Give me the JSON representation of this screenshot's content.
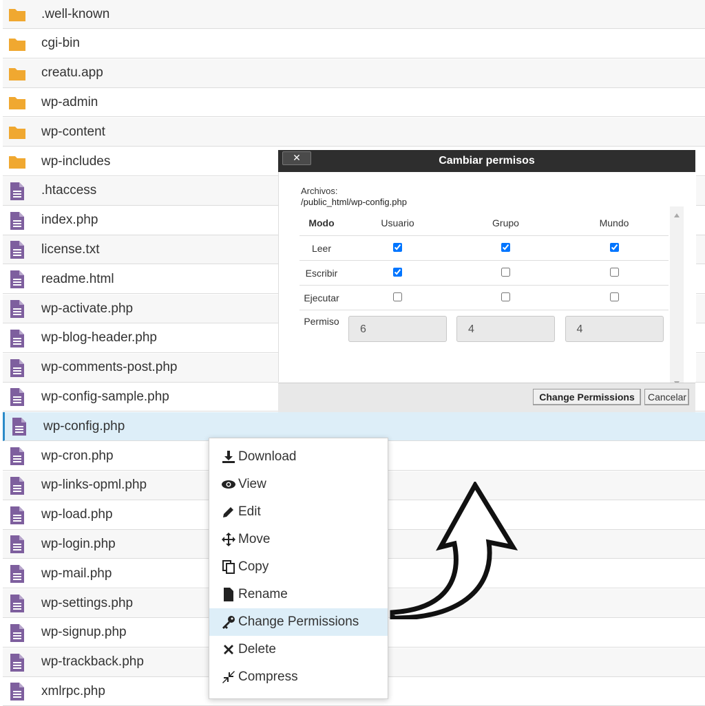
{
  "files": [
    {
      "name": ".well-known",
      "type": "folder"
    },
    {
      "name": "cgi-bin",
      "type": "folder"
    },
    {
      "name": "creatu.app",
      "type": "folder"
    },
    {
      "name": "wp-admin",
      "type": "folder"
    },
    {
      "name": "wp-content",
      "type": "folder"
    },
    {
      "name": "wp-includes",
      "type": "folder"
    },
    {
      "name": ".htaccess",
      "type": "file"
    },
    {
      "name": "index.php",
      "type": "file"
    },
    {
      "name": "license.txt",
      "type": "file"
    },
    {
      "name": "readme.html",
      "type": "file"
    },
    {
      "name": "wp-activate.php",
      "type": "file"
    },
    {
      "name": "wp-blog-header.php",
      "type": "file"
    },
    {
      "name": "wp-comments-post.php",
      "type": "file"
    },
    {
      "name": "wp-config-sample.php",
      "type": "file"
    },
    {
      "name": "wp-config.php",
      "type": "file",
      "selected": true
    },
    {
      "name": "wp-cron.php",
      "type": "file"
    },
    {
      "name": "wp-links-opml.php",
      "type": "file"
    },
    {
      "name": "wp-load.php",
      "type": "file"
    },
    {
      "name": "wp-login.php",
      "type": "file"
    },
    {
      "name": "wp-mail.php",
      "type": "file"
    },
    {
      "name": "wp-settings.php",
      "type": "file"
    },
    {
      "name": "wp-signup.php",
      "type": "file"
    },
    {
      "name": "wp-trackback.php",
      "type": "file"
    },
    {
      "name": "xmlrpc.php",
      "type": "file"
    }
  ],
  "colors": {
    "folder": "#f0a830",
    "file": "#7e5f9e",
    "selected_row": "#ddeef8",
    "dialog_header": "#2e2e2e"
  },
  "dialog": {
    "title": "Cambiar permisos",
    "close_label": "✕",
    "files_label": "Archivos:",
    "files_path": "/public_html/wp-config.php",
    "headers": {
      "mode": "Modo",
      "user": "Usuario",
      "group": "Grupo",
      "world": "Mundo"
    },
    "rows": [
      {
        "label": "Leer",
        "user": true,
        "group": true,
        "world": true
      },
      {
        "label": "Escribir",
        "user": true,
        "group": false,
        "world": false
      },
      {
        "label": "Ejecutar",
        "user": false,
        "group": false,
        "world": false
      }
    ],
    "permission_label": "Permiso",
    "permission_values": {
      "user": "6",
      "group": "4",
      "world": "4"
    },
    "buttons": {
      "change": "Change Permissions",
      "cancel": "Cancelar"
    }
  },
  "context_menu": {
    "items": [
      {
        "label": "Download",
        "icon": "download-icon"
      },
      {
        "label": "View",
        "icon": "eye-icon"
      },
      {
        "label": "Edit",
        "icon": "pencil-icon"
      },
      {
        "label": "Move",
        "icon": "move-icon"
      },
      {
        "label": "Copy",
        "icon": "copy-icon"
      },
      {
        "label": "Rename",
        "icon": "file-icon"
      },
      {
        "label": "Change Permissions",
        "icon": "key-icon",
        "highlighted": true
      },
      {
        "label": "Delete",
        "icon": "x-icon"
      },
      {
        "label": "Compress",
        "icon": "compress-icon"
      }
    ]
  }
}
